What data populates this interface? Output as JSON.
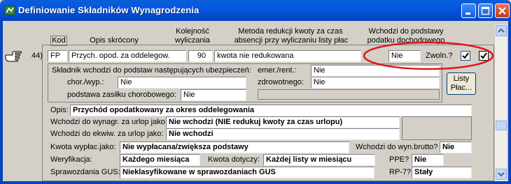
{
  "window": {
    "title": "Definiowanie Składników Wynagrodzenia"
  },
  "header": {
    "kod": "Kod",
    "opis": "Opis skrócony",
    "kolejnosc": [
      "Kolejność",
      "wyliczania"
    ],
    "metoda": [
      "Metoda redukcji kwoty za czas",
      "absencji przy wyliczaniu listy płac"
    ],
    "wchodzi": [
      "Wchodzi do podstawy",
      "podatku dochodowego"
    ]
  },
  "row": {
    "number": "44)",
    "kod": "FP",
    "opis_skrocony": "Przych. opod. za oddelegow.",
    "kolejnosc": "90",
    "metoda": "kwota nie redukowana",
    "wchodzi_podatek": "Nie",
    "zwoln_label": "Zwoln.?",
    "zwoln_checked": true,
    "row_checked": true
  },
  "insurance": {
    "heading": "Składnik wchodzi do podstaw następujących ubezpieczeń:",
    "chor_label": "chor./wyp.:",
    "chor_value": "Nie",
    "zasilek_label": "podstawa zasiłku chorobowego:",
    "zasilek_value": "Nie",
    "emer_label": "emer./rent.:",
    "emer_value": "Nie",
    "zdrow_label": "zdrowotnego:",
    "zdrow_value": "Nie",
    "listy_button": [
      "Listy",
      "Płac..."
    ]
  },
  "details": {
    "opis_label": "Opis:",
    "opis_value": "Przychód opodatkowany za okres oddelegowania",
    "urlop_label": "Wchodzi do wynagr. za urlop jako:",
    "urlop_value": "Nie wchodzi  (NIE redukuj kwoty za czas urlopu)",
    "ekwiw_label": "Wchodzi do ekwiw. za urlop jako:",
    "ekwiw_value": "Nie wchodzi",
    "kwota_label": "Kwota wypłac.jako:",
    "kwota_value": "Nie wypłacana/zwiększa podstawy",
    "brutto_label": "Wchodzi do wyn.brutto?",
    "brutto_value": "Nie",
    "weryf_label": "Weryfikacja:",
    "weryf_value": "Każdego miesiąca",
    "dotyczy_label": "Kwota dotyczy:",
    "dotyczy_value": "Każdej listy w miesiącu",
    "ppe_label": "PPE?",
    "ppe_value": "Nie",
    "gus_label": "Sprawozdania GUS:",
    "gus_value": "Nieklasyfikowane w sprawozdaniach GUS",
    "rp7_label": "RP-7?",
    "rp7_value": "Stały"
  },
  "colors": {
    "titlebar": "#0558e0",
    "annotation_oval": "#e0141e",
    "background": "#d4d0c8"
  },
  "icons": [
    "app-icon",
    "pointing-hand-icon",
    "minimize-icon",
    "maximize-icon",
    "close-icon",
    "scroll-up-icon",
    "scroll-down-icon"
  ]
}
